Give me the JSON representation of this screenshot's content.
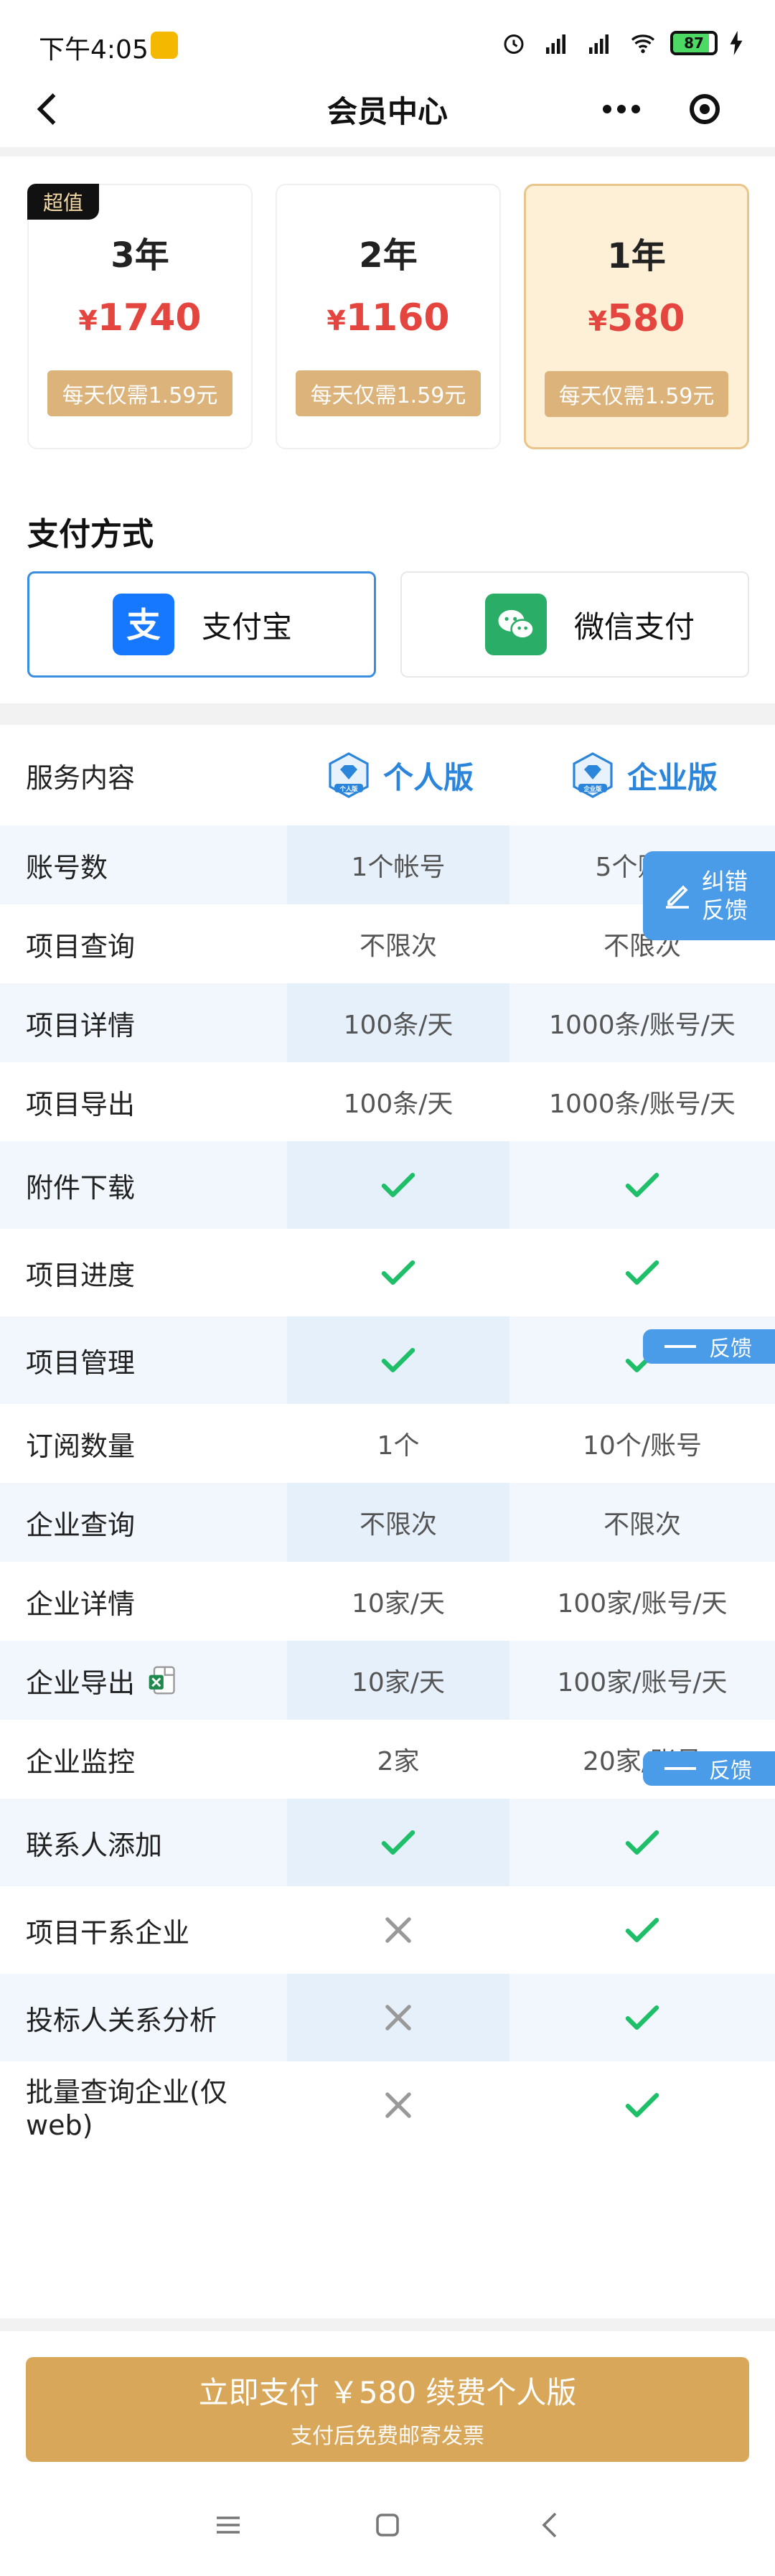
{
  "status_bar": {
    "time": "下午4:05",
    "battery": "87",
    "battery_level": 0.87
  },
  "nav": {
    "title": "会员中心"
  },
  "plans": [
    {
      "badge": "超值",
      "duration": "3年",
      "currency": "¥",
      "price": "1740",
      "daily": "每天仅需1.59元",
      "selected": false
    },
    {
      "badge": "",
      "duration": "2年",
      "currency": "¥",
      "price": "1160",
      "daily": "每天仅需1.59元",
      "selected": false
    },
    {
      "badge": "",
      "duration": "1年",
      "currency": "¥",
      "price": "580",
      "daily": "每天仅需1.59元",
      "selected": true
    }
  ],
  "payment": {
    "title": "支付方式",
    "options": [
      {
        "label": "支付宝",
        "icon": "alipay-icon",
        "color": "#1677ff",
        "selected": true
      },
      {
        "label": "微信支付",
        "icon": "wechat-pay-icon",
        "color": "#2aae67",
        "selected": false
      }
    ]
  },
  "table": {
    "header": {
      "label": "服务内容",
      "personal": "个人版",
      "enterprise": "企业版",
      "personal_badge": "个人版",
      "enterprise_badge": "企业版"
    },
    "rows": [
      {
        "label": "账号数",
        "personal": "1个帐号",
        "enterprise": "5个账号"
      },
      {
        "label": "项目查询",
        "personal": "不限次",
        "enterprise": "不限次"
      },
      {
        "label": "项目详情",
        "personal": "100条/天",
        "enterprise": "1000条/账号/天"
      },
      {
        "label": "项目导出",
        "personal": "100条/天",
        "enterprise": "1000条/账号/天"
      },
      {
        "label": "附件下载",
        "personal": "check",
        "enterprise": "check"
      },
      {
        "label": "项目进度",
        "personal": "check",
        "enterprise": "check"
      },
      {
        "label": "项目管理",
        "personal": "check",
        "enterprise": "check"
      },
      {
        "label": "订阅数量",
        "personal": "1个",
        "enterprise": "10个/账号"
      },
      {
        "label": "企业查询",
        "personal": "不限次",
        "enterprise": "不限次"
      },
      {
        "label": "企业详情",
        "personal": "10家/天",
        "enterprise": "100家/账号/天"
      },
      {
        "label": "企业导出",
        "personal": "10家/天",
        "enterprise": "100家/账号/天",
        "excel_icon": true
      },
      {
        "label": "企业监控",
        "personal": "2家",
        "enterprise": "20家/账号"
      },
      {
        "label": "联系人添加",
        "personal": "check",
        "enterprise": "check"
      },
      {
        "label": "项目干系企业",
        "personal": "cross",
        "enterprise": "check"
      },
      {
        "label": "投标人关系分析",
        "personal": "cross",
        "enterprise": "check"
      },
      {
        "label": "批量查询企业(仅web)",
        "personal": "cross",
        "enterprise": "check"
      }
    ]
  },
  "feedback": {
    "line1": "纠错",
    "line2": "反馈",
    "mini": "反馈"
  },
  "pay_button": {
    "main": "立即支付 ￥580 续费个人版",
    "sub": "支付后免费邮寄发票"
  },
  "colors": {
    "check": "#1fbf6a",
    "cross": "#999999",
    "accent": "#2b86db",
    "gold": "#d8a75a",
    "price": "#e4463f"
  }
}
